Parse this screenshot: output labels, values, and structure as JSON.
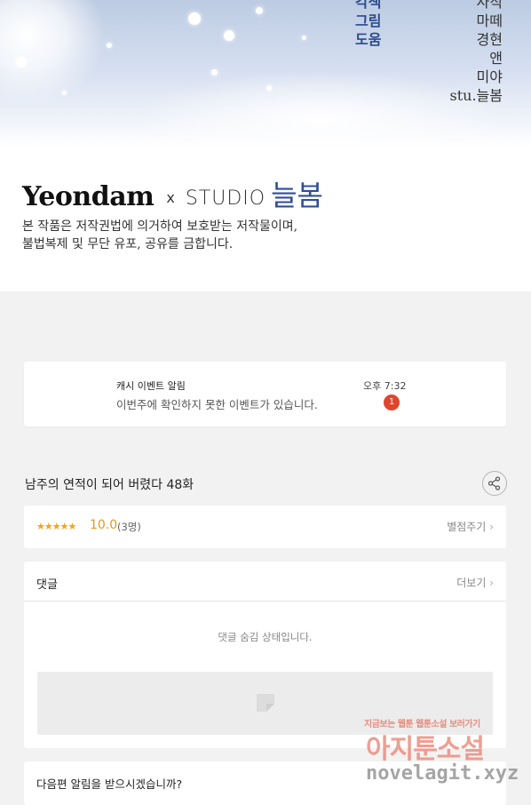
{
  "credits": {
    "roles": [
      "각색",
      "그림",
      "도움"
    ],
    "names": [
      "사직",
      "마떼",
      "경현",
      "앤",
      "미야",
      "stu.늘봄"
    ]
  },
  "logo": {
    "publisher": "Yeondam",
    "cross": "x",
    "studio_word": "STUDIO",
    "studio_name": "늘봄"
  },
  "copyright_lines": [
    "본 작품은 저작권법에 의거하여 보호받는 저작물이며,",
    "불법복제 및 무단 유포, 공유를 금합니다."
  ],
  "notification": {
    "title": "캐시 이벤트 알림",
    "message": "이번주에 확인하지 못한 이벤트가 있습니다.",
    "time": "오후 7:32",
    "badge": "1"
  },
  "episode": {
    "title": "남주의 연적이 되어 버렸다 48화"
  },
  "rating": {
    "stars": "★★★★★",
    "score": "10.0",
    "count": "(3명)",
    "rate_label": "별점주기"
  },
  "comments": {
    "title": "댓글",
    "more_label": "더보기",
    "hidden_message": "댓글 숨김 상태입니다."
  },
  "next_notice": {
    "question": "다음편 알림을 받으시겠습니까?"
  },
  "watermark": {
    "tagline": "지금보는 웹툰 웹툰소설 보러가기",
    "brand": "아지툰소설",
    "domain": "novelagit.xyz"
  },
  "colors": {
    "accent_blue": "#2e4f9a",
    "rating_orange": "#e8961a",
    "badge_red": "#e0452d"
  }
}
